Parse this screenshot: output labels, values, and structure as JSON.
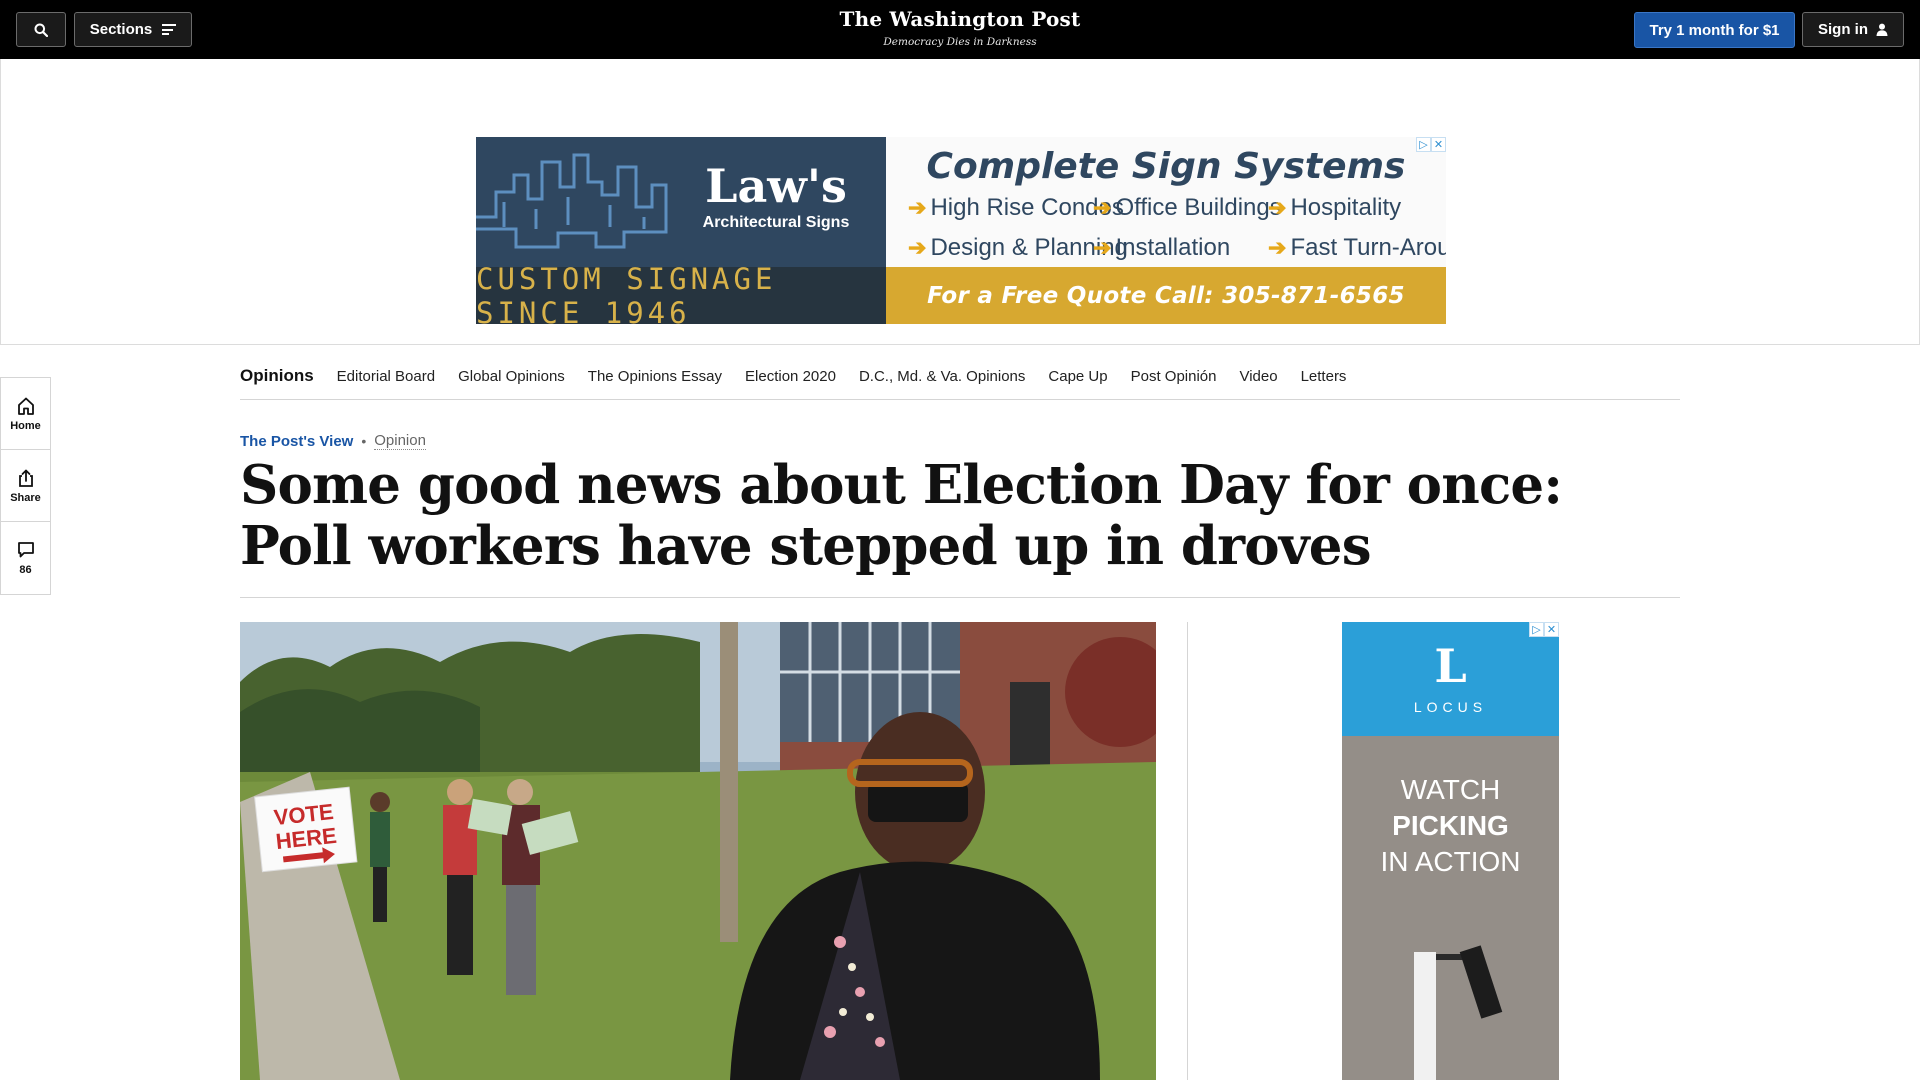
{
  "header": {
    "search_label": "",
    "sections_label": "Sections",
    "logo": "The Washington Post",
    "tagline": "Democracy Dies in Darkness",
    "try_label": "Try 1 month for $1",
    "signin_label": "Sign in"
  },
  "top_ad": {
    "brand_name": "Law's",
    "brand_sub": "Architectural Signs",
    "since": "CUSTOM SIGNAGE SINCE 1946",
    "headline": "Complete Sign Systems",
    "features": [
      "High Rise Condos",
      "Office Buildings",
      "Hospitality",
      "Design & Planning",
      "Installation",
      "Fast Turn-Around"
    ],
    "quote": "For a Free Quote Call: 305-871-6565"
  },
  "rail": {
    "home_label": "Home",
    "share_label": "Share",
    "comments_count": "86"
  },
  "section_nav": {
    "title": "Opinions",
    "links": [
      "Editorial Board",
      "Global Opinions",
      "The Opinions Essay",
      "Election 2020",
      "D.C., Md. & Va. Opinions",
      "Cape Up",
      "Post Opinión",
      "Video",
      "Letters"
    ]
  },
  "article": {
    "kicker_label": "The Post's View",
    "section_label": "Opinion",
    "headline": "Some good news about Election Day for once: Poll workers have stepped up in droves"
  },
  "photo": {
    "sign_text_1": "VOTE",
    "sign_text_2": "HERE"
  },
  "side_ad": {
    "brand": "LOCUS",
    "line1": "WATCH",
    "line2": "PICKING",
    "line3": "IN ACTION"
  },
  "colors": {
    "accent_blue": "#1955a5",
    "header_bg": "#000000",
    "ad_navy": "#2f4760",
    "ad_gold": "#d7a830",
    "locus_blue": "#2b9fd8"
  },
  "icons": [
    "search-icon",
    "menu-icon",
    "user-icon",
    "home-icon",
    "share-icon",
    "comment-icon",
    "adchoices-icon",
    "close-icon"
  ]
}
